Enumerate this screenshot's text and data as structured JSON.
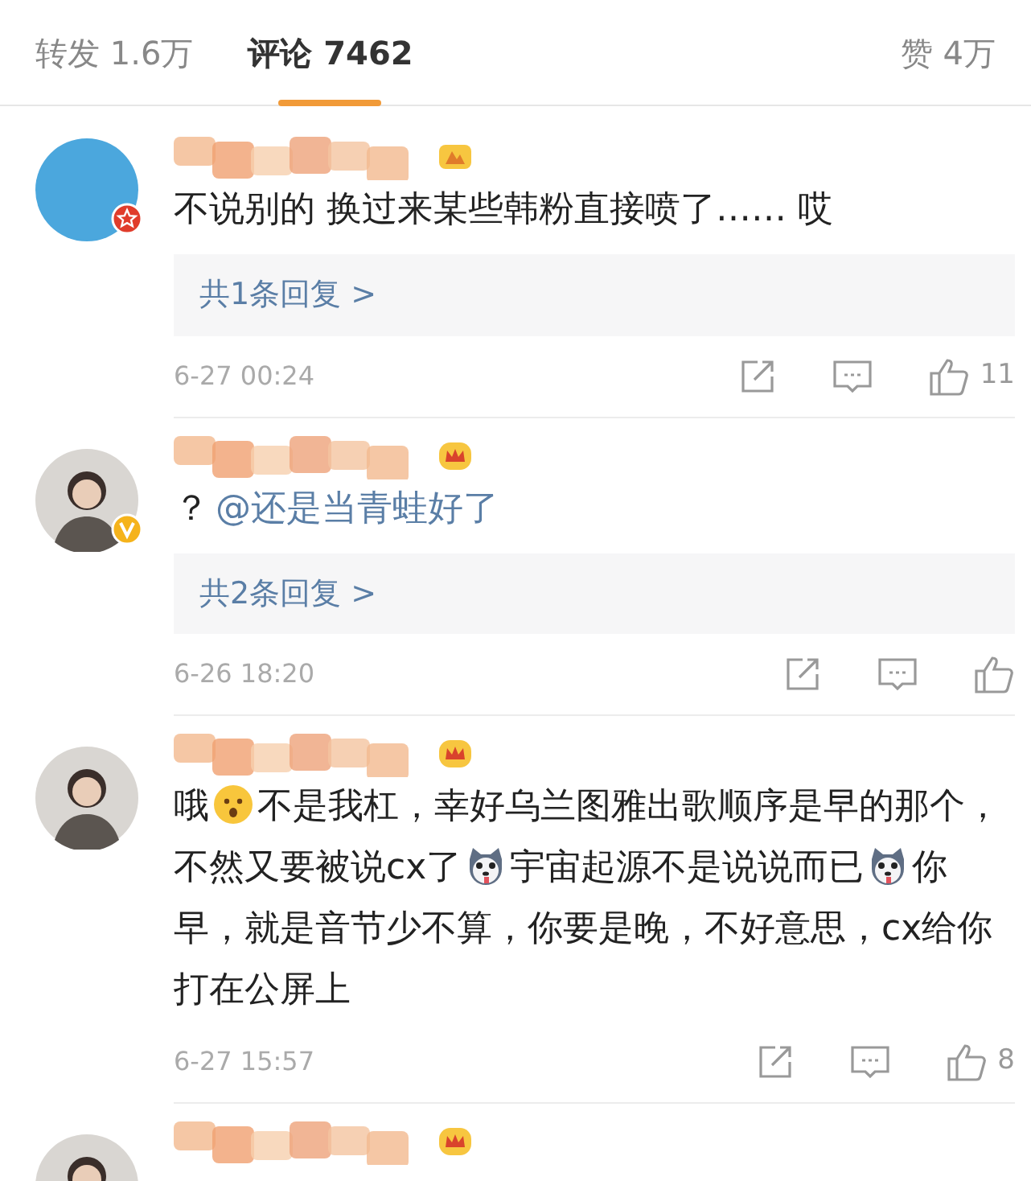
{
  "tabs": [
    {
      "label": "转发 1.6万",
      "selected": false
    },
    {
      "label": "评论 7462",
      "selected": true
    },
    {
      "label": "赞 4万",
      "selected": false
    }
  ],
  "comments": [
    {
      "avatar": {
        "kind": "plain"
      },
      "avatar_badge": {
        "kind": "star"
      },
      "name_badge": {
        "kind": "medal"
      },
      "segments": [
        {
          "kind": "text",
          "text": "不说别的 换过来某些韩粉直接喷了…… 哎"
        }
      ],
      "replies": "共1条回复 >",
      "time": "6-27 00:24",
      "likes": "11"
    },
    {
      "avatar": {
        "kind": "figure"
      },
      "avatar_badge": {
        "kind": "verified"
      },
      "name_badge": {
        "kind": "crown"
      },
      "segments": [
        {
          "kind": "text",
          "text": "？"
        },
        {
          "kind": "mention",
          "text": "@还是当青蛙好了"
        }
      ],
      "replies": "共2条回复 >",
      "time": "6-26 18:20"
    },
    {
      "avatar": {
        "kind": "figure"
      },
      "name_badge": {
        "kind": "crown"
      },
      "segments": [
        {
          "kind": "text",
          "text": "哦"
        },
        {
          "kind": "surprised"
        },
        {
          "kind": "text",
          "text": "不是我杠，幸好乌兰图雅出歌顺序是早的那个，不然又要被说cx了"
        },
        {
          "kind": "dog"
        },
        {
          "kind": "text",
          "text": "宇宙起源不是说说而已"
        },
        {
          "kind": "dog"
        },
        {
          "kind": "text",
          "text": "你早，就是音节少不算，你要是晚，不好意思，cx给你打在公屏上"
        }
      ],
      "time": "6-27 15:57",
      "likes": "8"
    },
    {
      "avatar": {
        "kind": "figure"
      },
      "name_badge": {
        "kind": "crown"
      }
    }
  ]
}
